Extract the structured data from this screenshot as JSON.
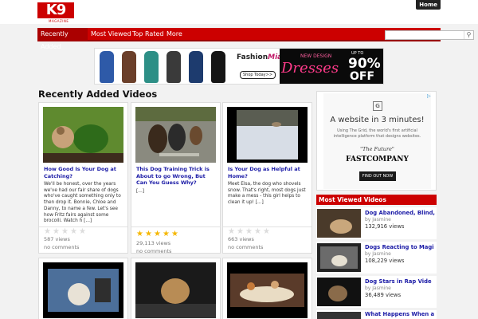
{
  "site": {
    "logo_text": "K9",
    "logo_sub": "MAGAZINE",
    "home_label": "Home"
  },
  "nav": {
    "items": [
      {
        "label": "Recently Added"
      },
      {
        "label": "Most Viewed"
      },
      {
        "label": "Top Rated"
      },
      {
        "label": "More"
      }
    ],
    "search_placeholder": ""
  },
  "banner": {
    "brand_main": "Fashion",
    "brand_accent": "Mia",
    "shop_label": "Shop Today>>",
    "new_design": "NEW DESIGN",
    "dresses": "Dresses",
    "up_to": "UP TO",
    "percent": "90%",
    "off": "OFF"
  },
  "main": {
    "section_title": "Recently Added Videos",
    "cards": [
      {
        "title": "How Good Is Your Dog at Catching?",
        "excerpt": "We'll be honest, over the years we've had our fair share of dogs who've caught something only to then drop it. Bonnie, Chloe and Danny, to name a few. Let's see how Fritz fairs against some brocolli. Watch h [...]",
        "rating": 0,
        "views": "587 views",
        "comments": "no comments"
      },
      {
        "title": "This Dog Training Trick is About to go Wrong, But Can You Guess Why?",
        "excerpt": "[...]",
        "rating": 5,
        "views": "29,113 views",
        "comments": "no comments"
      },
      {
        "title": "Is Your Dog as Helpful at Home?",
        "excerpt": "Meet Elsa, the dog who shovels snow. That's right, most dogs just make a mess - this girl helps to clean it up!   [...]",
        "rating": 0,
        "views": "663 views",
        "comments": "no comments"
      }
    ]
  },
  "sidebar": {
    "ad": {
      "logo_letter": "G",
      "headline": "A website in 3 minutes!",
      "sub": "Using The Grid, the world's first artificial intelligence platform that designs websites.",
      "future": "\"The Future\"",
      "source": "FASTCOMPANY",
      "cta": "FIND OUT NOW",
      "adchoice": "▷"
    },
    "most_viewed_title": "Most Viewed Videos",
    "most_viewed": [
      {
        "title": "Dog Abandoned, Blind,",
        "by": "by Jasmine",
        "views": "132,916 views"
      },
      {
        "title": "Dogs Reacting to Magi",
        "by": "by Jasmine",
        "views": "108,229 views"
      },
      {
        "title": "Dog Stars in Rap Vide",
        "by": "by Jasmine",
        "views": "36,489 views"
      },
      {
        "title": "What Happens When a D",
        "by": "",
        "views": ""
      }
    ]
  },
  "colors": {
    "brand_red": "#cc0000",
    "link_blue": "#1a1aa6",
    "star_gold": "#f5b700"
  }
}
